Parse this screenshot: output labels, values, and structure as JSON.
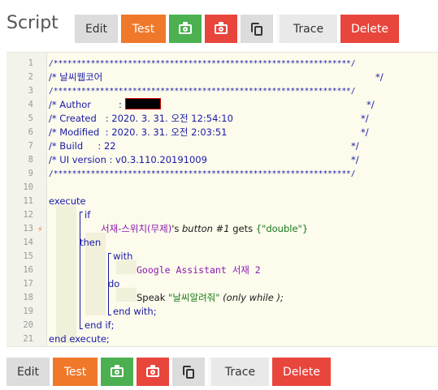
{
  "page": {
    "heading": "Script"
  },
  "toolbar": {
    "edit": "Edit",
    "test": "Test",
    "camera_green_icon": "camera-icon",
    "camera_red_icon": "camera-icon",
    "copy_icon": "copy-icon",
    "trace": "Trace",
    "delete": "Delete",
    "colors": {
      "test": "#f0782a",
      "green": "#4cb050",
      "red": "#e8453c",
      "gray": "#dcdcdc"
    }
  },
  "editor": {
    "line_numbers": [
      "1",
      "2",
      "3",
      "4",
      "5",
      "6",
      "7",
      "8",
      "9",
      "10",
      "11",
      "12",
      "13",
      "14",
      "15",
      "16",
      "17",
      "18",
      "19",
      "20",
      "21"
    ],
    "header": {
      "border": "/****************************************************************/",
      "title": "/* 날씨웹코어",
      "close": "*/",
      "author_label": "/* Author",
      "author_colon": ":",
      "created": "/* Created   : 2020. 3. 31. 오전 12:54:10",
      "modified": "/* Modified  : 2020. 3. 31. 오전 2:03:51",
      "build": "/* Build     : 22",
      "ui_version": "/* UI version : v0.3.110.20191009"
    },
    "code": {
      "execute": "execute",
      "if": "if",
      "condition_device": "서재-스위치(무제)",
      "condition_possessive": "'s ",
      "condition_attr": "button #1",
      "condition_op": " gets ",
      "condition_value": "{\"double\"}",
      "then": "then",
      "with": "with",
      "with_device": "Google Assistant 서재 2",
      "do": "do",
      "speak": "Speak ",
      "speak_value": "\"날씨알려줘\"",
      "speak_option": " (only while );",
      "end_with": "end with;",
      "end_if": "end if;",
      "end_execute": "end execute;"
    }
  }
}
